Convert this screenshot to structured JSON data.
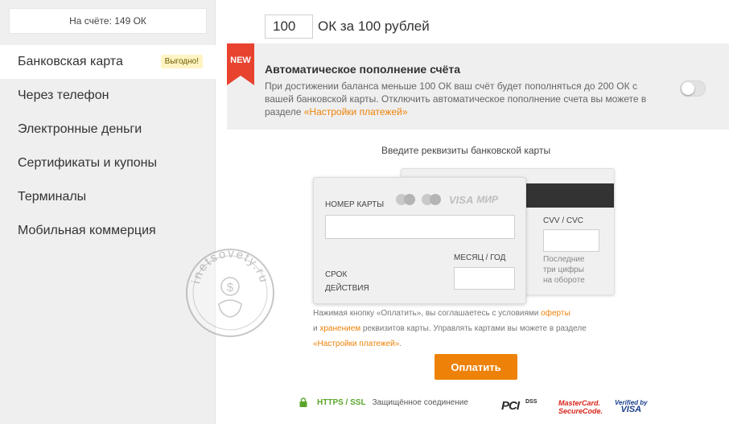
{
  "sidebar": {
    "balance": "На счёте: 149 ОК",
    "items": [
      {
        "label": "Банковская карта",
        "badge": "Выгодно!",
        "active": true
      },
      {
        "label": "Через телефон"
      },
      {
        "label": "Электронные деньги"
      },
      {
        "label": "Сертификаты и купоны"
      },
      {
        "label": "Терминалы"
      },
      {
        "label": "Мобильная коммерция"
      }
    ]
  },
  "amount": {
    "value": "100",
    "text": "ОК за 100 рублей"
  },
  "autopay": {
    "ribbon": "NEW",
    "title": "Автоматическое пополнение счёта",
    "desc": "При достижении баланса меньше 100 ОК ваш счёт будет пополняться до 200 ОК с вашей банковской карты. Отключить автоматическое пополнение счета вы можете в разделе ",
    "link": "«Настройки платежей»",
    "enabled": false
  },
  "card": {
    "title": "Введите реквизиты банковской карты",
    "number_label": "НОМЕР КАРТЫ",
    "brands": {
      "visa": "VISA",
      "mir": "МИР"
    },
    "expiry_label": "СРОК ДЕЙСТВИЯ",
    "month_year_label": "МЕСЯЦ / ГОД",
    "cvv_label": "CVV / CVC",
    "cvv_hint": "Последние три цифры на обороте"
  },
  "terms": {
    "part1": "Нажимая кнопку «Оплатить», вы соглашаетесь с условиями ",
    "link_offer": "оферты",
    "part2": "и ",
    "link_storage": "хранением",
    "part3": " реквизитов карты. Управлять картами вы можете в разделе ",
    "link_settings": "«Настройки платежей»",
    "part4": "."
  },
  "pay_button": "Оплатить",
  "security": {
    "https": "HTTPS / SSL",
    "text": "Защищённое соединение",
    "logos": {
      "pci": "PCI",
      "pci_dss": "DSS",
      "mc_line1": "MasterCard.",
      "mc_line2": "SecureCode.",
      "vbv_line1": "Verified by",
      "vbv_line2": "VISA"
    }
  },
  "watermark": "inetsovety.ru",
  "colors": {
    "accent": "#ee8208",
    "ribbon": "#e8432f",
    "https": "#5aa52a",
    "sidebar_bg": "#efefef"
  }
}
